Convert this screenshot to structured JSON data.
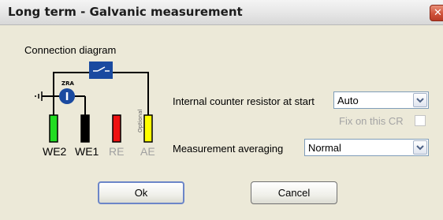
{
  "window": {
    "title": "Long term - Galvanic measurement",
    "close_icon": "close-icon"
  },
  "diagram": {
    "title": "Connection diagram",
    "zra_label": "ZRA",
    "zra_symbol": "I",
    "optional_label": "Optional",
    "electrodes": [
      {
        "name": "WE2",
        "color": "#22dd22"
      },
      {
        "name": "WE1",
        "color": "#000000"
      },
      {
        "name": "RE",
        "color": "#ee1111"
      },
      {
        "name": "AE",
        "color": "#ffff00"
      }
    ],
    "active_label_color": "#000000",
    "inactive_label_color": "#a0a0a0"
  },
  "form": {
    "counter_resistor_label": "Internal counter resistor at start",
    "counter_resistor_value": "Auto",
    "fix_label": "Fix on this CR",
    "fix_checked": false,
    "averaging_label": "Measurement averaging",
    "averaging_value": "Normal"
  },
  "buttons": {
    "ok": "Ok",
    "cancel": "Cancel"
  }
}
